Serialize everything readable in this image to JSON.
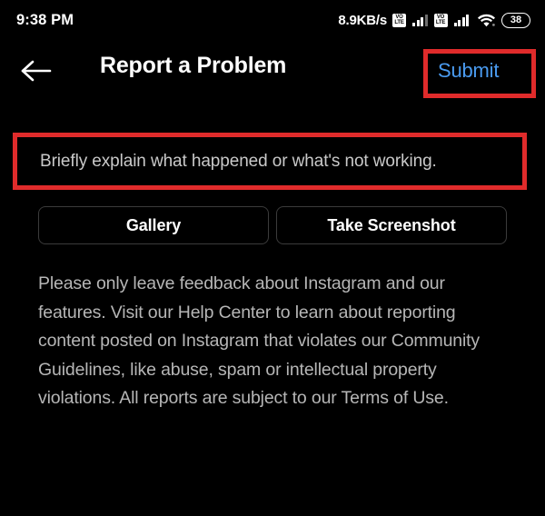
{
  "status_bar": {
    "clock": "9:38 PM",
    "network_speed": "8.9KB/s",
    "volte_top": "VO",
    "volte_bottom": "LTE",
    "sim1_icon": "volte-signal-icon",
    "sim2_icon": "volte-signal-icon",
    "wifi_icon": "wifi-icon",
    "battery_level": "38"
  },
  "header": {
    "back_icon": "back-arrow-icon",
    "title": "Report a Problem",
    "submit_label": "Submit",
    "submit_color": "#4a9bf0"
  },
  "form": {
    "input_placeholder": "Briefly explain what happened or what's not working.",
    "input_value": "",
    "gallery_label": "Gallery",
    "screenshot_label": "Take Screenshot"
  },
  "disclaimer": {
    "text": "Please only leave feedback about Instagram and our features. Visit our Help Center to learn about reporting content posted on Instagram that violates our Community Guidelines, like abuse, spam or intellectual property violations. All reports are subject to our Terms of Use."
  },
  "annotations": {
    "highlight_color": "#e02b2b",
    "submit_box": "submit-button-highlight",
    "input_box": "problem-input-highlight"
  }
}
